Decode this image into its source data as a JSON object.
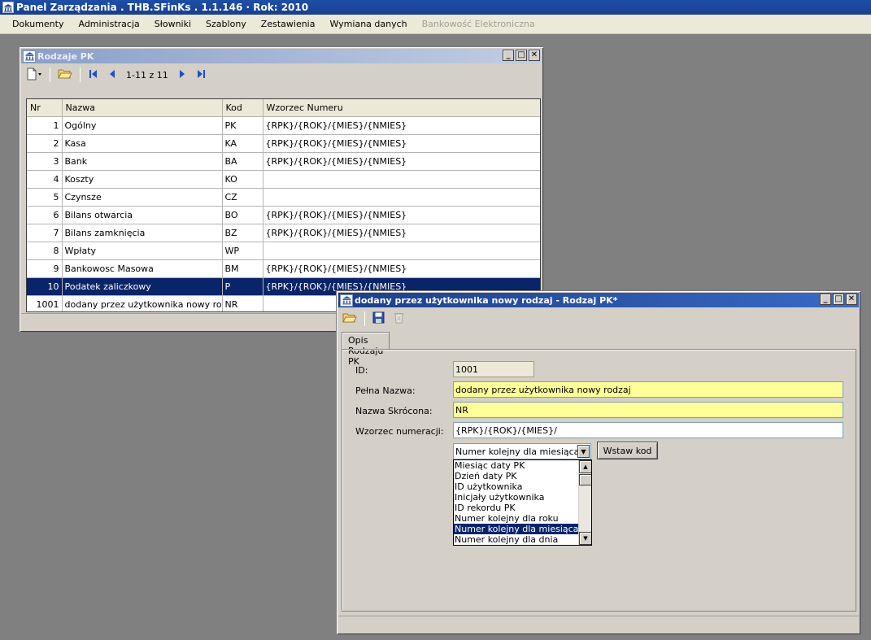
{
  "app": {
    "title": "Panel Zarządzania . THB.SFinKs . 1.1.146 · Rok: 2010",
    "menu": [
      {
        "label": "Dokumenty",
        "enabled": true
      },
      {
        "label": "Administracja",
        "enabled": true
      },
      {
        "label": "Słowniki",
        "enabled": true
      },
      {
        "label": "Szablony",
        "enabled": true
      },
      {
        "label": "Zestawienia",
        "enabled": true
      },
      {
        "label": "Wymiana danych",
        "enabled": true
      },
      {
        "label": "Bankowość Elektroniczna",
        "enabled": false
      }
    ]
  },
  "list_window": {
    "title": "Rodzaje PK",
    "pager": "1-11 z 11",
    "columns": [
      "Nr",
      "Nazwa",
      "Kod",
      "Wzorzec Numeru"
    ],
    "rows": [
      {
        "nr": "1",
        "nazwa": "Ogólny",
        "kod": "PK",
        "wzorzec": "{RPK}/{ROK}/{MIES}/{NMIES}"
      },
      {
        "nr": "2",
        "nazwa": "Kasa",
        "kod": "KA",
        "wzorzec": "{RPK}/{ROK}/{MIES}/{NMIES}"
      },
      {
        "nr": "3",
        "nazwa": "Bank",
        "kod": "BA",
        "wzorzec": "{RPK}/{ROK}/{MIES}/{NMIES}"
      },
      {
        "nr": "4",
        "nazwa": "Koszty",
        "kod": "KO",
        "wzorzec": ""
      },
      {
        "nr": "5",
        "nazwa": "Czynsze",
        "kod": "CZ",
        "wzorzec": ""
      },
      {
        "nr": "6",
        "nazwa": "Bilans otwarcia",
        "kod": "BO",
        "wzorzec": "{RPK}/{ROK}/{MIES}/{NMIES}"
      },
      {
        "nr": "7",
        "nazwa": "Bilans zamknięcia",
        "kod": "BZ",
        "wzorzec": "{RPK}/{ROK}/{MIES}/{NMIES}"
      },
      {
        "nr": "8",
        "nazwa": "Wpłaty",
        "kod": "WP",
        "wzorzec": ""
      },
      {
        "nr": "9",
        "nazwa": "Bankowosc Masowa",
        "kod": "BM",
        "wzorzec": "{RPK}/{ROK}/{MIES}/{NMIES}"
      },
      {
        "nr": "10",
        "nazwa": "Podatek zaliczkowy",
        "kod": "P",
        "wzorzec": "{RPK}/{ROK}/{MIES}/{NMIES}",
        "selected": true
      },
      {
        "nr": "1001",
        "nazwa": "dodany przez użytkownika nowy rodzaj",
        "kod": "NR",
        "wzorzec": ""
      }
    ]
  },
  "form_window": {
    "title": "dodany przez użytkownika nowy rodzaj - Rodzaj PK*",
    "tab": "Opis Rodzaju PK",
    "fields": {
      "id": {
        "label": "ID:",
        "value": "1001"
      },
      "pelna_nazwa": {
        "label": "Pełna Nazwa:",
        "value": "dodany przez użytkownika nowy rodzaj"
      },
      "nazwa_skrocona": {
        "label": "Nazwa Skrócona:",
        "value": "NR"
      },
      "wzorzec": {
        "label": "Wzorzec numeracji:",
        "value": "{RPK}/{ROK}/{MIES}/"
      }
    },
    "combo": {
      "selected": "Numer kolejny dla miesiąca",
      "options": [
        "Miesiąc daty PK",
        "Dzień daty PK",
        "ID użytkownika",
        "Inicjały użytkownika",
        "ID rekordu PK",
        "Numer kolejny dla roku",
        "Numer kolejny dla miesiąca",
        "Numer kolejny dla dnia"
      ]
    },
    "insert_button": "Wstaw kod"
  },
  "colors": {
    "selection": "#0a246a",
    "required_field": "#ffff99",
    "title_active": "#1c3f8a"
  }
}
